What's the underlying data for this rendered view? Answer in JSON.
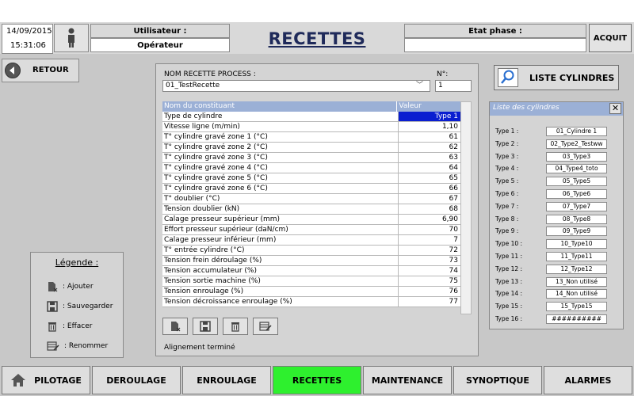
{
  "header": {
    "date": "14/09/2015",
    "time": "15:31:06",
    "user_label": "Utilisateur :",
    "user_value": "Opérateur",
    "title": "RECETTES",
    "etat_label": "Etat phase :",
    "etat_value": "",
    "acquit": "ACQUIT"
  },
  "retour": "RETOUR",
  "legend": {
    "title": "Légende :",
    "items": [
      ": Ajouter",
      ": Sauvegarder",
      ": Effacer",
      ": Renommer"
    ]
  },
  "recipe": {
    "name_label": "NOM RECETTE PROCESS :",
    "name_value": "01_TestRecette",
    "num_label": "N°:",
    "num_value": "1"
  },
  "table": {
    "col_name": "Nom du constituant",
    "col_value": "Valeur",
    "rows": [
      {
        "name": "Type de cylindre",
        "value": "Type 1"
      },
      {
        "name": "Vitesse ligne (m/min)",
        "value": "1,10"
      },
      {
        "name": "T° cylindre gravé zone 1 (°C)",
        "value": "61"
      },
      {
        "name": "T° cylindre gravé zone 2 (°C)",
        "value": "62"
      },
      {
        "name": "T° cylindre gravé zone 3 (°C)",
        "value": "63"
      },
      {
        "name": "T° cylindre gravé zone 4 (°C)",
        "value": "64"
      },
      {
        "name": "T° cylindre gravé zone 5 (°C)",
        "value": "65"
      },
      {
        "name": "T° cylindre gravé zone 6 (°C)",
        "value": "66"
      },
      {
        "name": "T° doublier (°C)",
        "value": "67"
      },
      {
        "name": "Tension doublier (kN)",
        "value": "68"
      },
      {
        "name": "Calage presseur supérieur (mm)",
        "value": "6,90"
      },
      {
        "name": "Effort presseur supérieur (daN/cm)",
        "value": "70"
      },
      {
        "name": "Calage presseur inférieur (mm)",
        "value": "7"
      },
      {
        "name": "T° entrée cylindre (°C)",
        "value": "72"
      },
      {
        "name": "Tension frein déroulage (%)",
        "value": "73"
      },
      {
        "name": "Tension accumulateur (%)",
        "value": "74"
      },
      {
        "name": "Tension sortie machine (%)",
        "value": "75"
      },
      {
        "name": "Tension enroulage (%)",
        "value": "76"
      },
      {
        "name": "Tension décroissance enroulage (%)",
        "value": "77"
      }
    ]
  },
  "status": "Alignement terminé",
  "cylinders": {
    "button": "LISTE CYLINDRES",
    "title": "Liste des cylindres",
    "close": "✕",
    "items": [
      {
        "label": "Type 1 :",
        "value": "01_Cylindre 1"
      },
      {
        "label": "Type 2 :",
        "value": "02_Type2_Testww"
      },
      {
        "label": "Type 3 :",
        "value": "03_Type3"
      },
      {
        "label": "Type 4 :",
        "value": "04_Type4_toto"
      },
      {
        "label": "Type 5 :",
        "value": "05_Type5"
      },
      {
        "label": "Type 6 :",
        "value": "06_Type6"
      },
      {
        "label": "Type 7 :",
        "value": "07_Type7"
      },
      {
        "label": "Type 8 :",
        "value": "08_Type8"
      },
      {
        "label": "Type 9 :",
        "value": "09_Type9"
      },
      {
        "label": "Type 10 :",
        "value": "10_Type10"
      },
      {
        "label": "Type 11 :",
        "value": "11_Type11"
      },
      {
        "label": "Type 12 :",
        "value": "12_Type12"
      },
      {
        "label": "Type 13 :",
        "value": "13_Non utilisé"
      },
      {
        "label": "Type 14 :",
        "value": "14_Non utilisé"
      },
      {
        "label": "Type 15 :",
        "value": "15_Type15"
      },
      {
        "label": "Type 16 :",
        "value": "##########"
      }
    ]
  },
  "nav": [
    "PILOTAGE",
    "DEROULAGE",
    "ENROULAGE",
    "RECETTES",
    "MAINTENANCE",
    "SYNOPTIQUE",
    "ALARMES"
  ],
  "colors": {
    "active_tab": "#2ef02e",
    "selected_cell": "#0a1ed0",
    "table_header": "#9bb0d6",
    "title": "#1f2a5a"
  }
}
